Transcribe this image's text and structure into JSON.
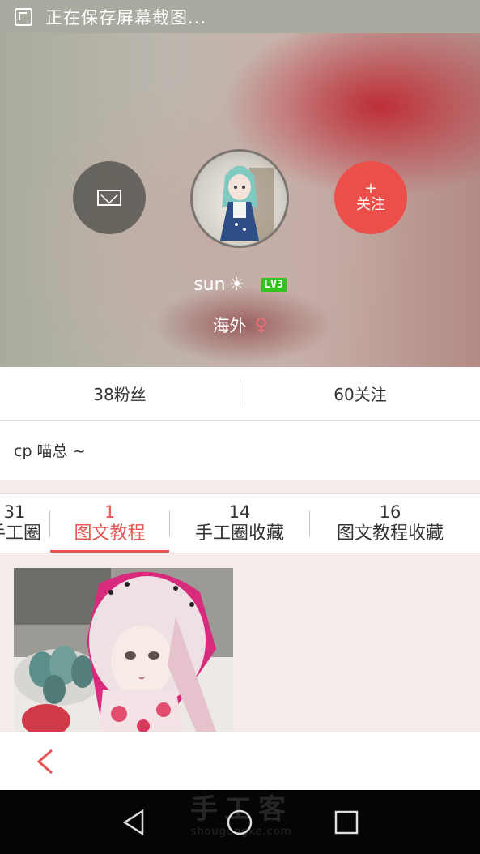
{
  "status_bar": {
    "icon": "screenshot-icon",
    "text": "正在保存屏幕截图..."
  },
  "profile": {
    "username": "sun",
    "level_badge": "LV3",
    "location": "海外",
    "follow_button": {
      "plus": "+",
      "label": "关注"
    },
    "message_icon": "envelope-icon",
    "sun_icon": "sun-icon",
    "gender_icon": "female-icon"
  },
  "stats": {
    "fans": "38粉丝",
    "following": "60关注"
  },
  "bio": "cp 喵总 ~",
  "tabs": [
    {
      "count": "31",
      "label": "手工圈"
    },
    {
      "count": "1",
      "label": "图文教程"
    },
    {
      "count": "14",
      "label": "手工圈收藏"
    },
    {
      "count": "16",
      "label": "图文教程收藏"
    }
  ],
  "active_tab": "图文教程",
  "watermark": {
    "line1": "手工客",
    "line2": "shougongke.com"
  },
  "colors": {
    "accent": "#e55450",
    "follow_bg": "#ec4f4a",
    "level_green": "#33c21f",
    "female": "#f06f78"
  }
}
